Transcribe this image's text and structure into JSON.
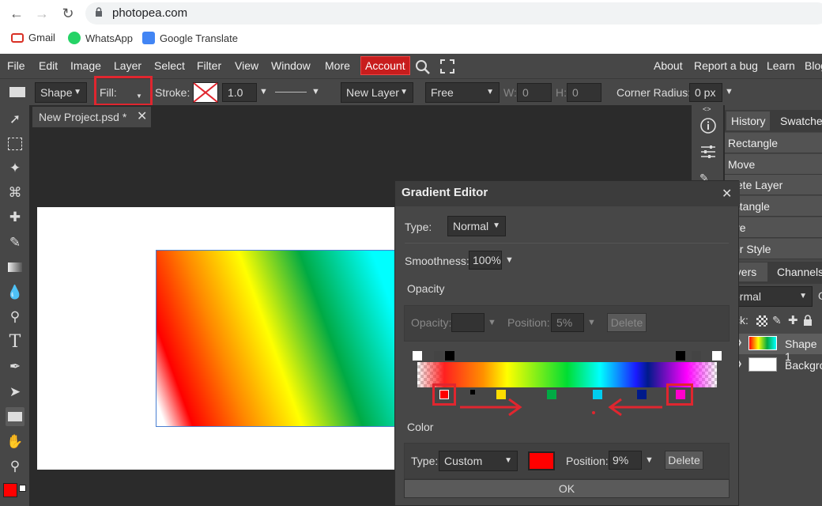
{
  "browser": {
    "url": "photopea.com",
    "bookmarks": [
      "Gmail",
      "WhatsApp",
      "Google Translate"
    ]
  },
  "menu": {
    "items": [
      "File",
      "Edit",
      "Image",
      "Layer",
      "Select",
      "Filter",
      "View",
      "Window",
      "More"
    ],
    "account": "Account",
    "right_items": [
      "About",
      "Report a bug",
      "Learn",
      "Blog"
    ]
  },
  "toolbar": {
    "shape_select": "Shape",
    "fill_label": "Fill:",
    "stroke_label": "Stroke:",
    "stroke_width": "1.0 px",
    "layer_mode": "New Layer",
    "size_mode": "Free",
    "w_label": "W:",
    "w_value": "0",
    "h_label": "H:",
    "h_value": "0",
    "corner_label": "Corner Radius:",
    "corner_value": "0 px"
  },
  "document": {
    "tab_title": "New Project.psd *"
  },
  "panels": {
    "tabs": [
      "History",
      "Swatches"
    ],
    "history": [
      "Rectangle",
      "Move",
      "elete Layer",
      "ectangle",
      "ove",
      "yer Style"
    ],
    "layer_tabs": [
      "ayers",
      "Channels"
    ],
    "blend_mode": "ormal",
    "lock_label": "ck:",
    "layers": [
      "Shape 1",
      "Backgro"
    ]
  },
  "gradient_editor": {
    "title": "Gradient Editor",
    "type_label": "Type:",
    "type_value": "Normal",
    "smoothness_label": "Smoothness:",
    "smoothness_value": "100%",
    "opacity_section": "Opacity",
    "opacity_label": "Opacity:",
    "opacity_value": "",
    "opacity_position_label": "Position:",
    "opacity_position_value": "5%",
    "opacity_delete": "Delete",
    "color_section": "Color",
    "color_type_label": "Type:",
    "color_type_value": "Custom",
    "color_swatch": "#ff0000",
    "color_position_label": "Position:",
    "color_position_value": "9%",
    "color_delete": "Delete",
    "ok": "OK"
  },
  "colors": {
    "accent_red": "#e0262f",
    "foreground": "#ff0000",
    "background": "#ffffff"
  }
}
